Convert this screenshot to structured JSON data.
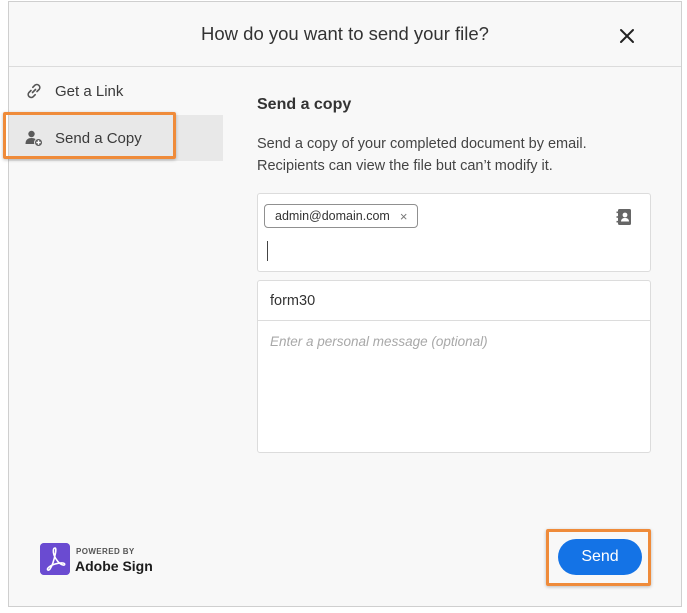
{
  "dialog": {
    "title": "How do you want to send your file?",
    "close_icon": "close-icon"
  },
  "sidebar": {
    "items": [
      {
        "label": "Get a Link",
        "icon": "link-icon",
        "active": false
      },
      {
        "label": "Send a Copy",
        "icon": "add-user-icon",
        "active": true
      }
    ]
  },
  "main": {
    "section_title": "Send a copy",
    "description_line1": "Send a copy of your completed document by email.",
    "description_line2": "Recipients can view the file but can’t modify it.",
    "recipients": [
      {
        "email": "admin@domain.com",
        "remove_glyph": "×"
      }
    ],
    "contacts_icon": "address-book-icon",
    "subject_value": "form30",
    "message_placeholder": "Enter a personal message (optional)"
  },
  "footer": {
    "brand_powered": "POWERED BY",
    "brand_name": "Adobe Sign",
    "send_label": "Send"
  },
  "colors": {
    "accent": "#1473e6",
    "highlight": "#ef8b3a",
    "brand": "#6a4bd1"
  }
}
